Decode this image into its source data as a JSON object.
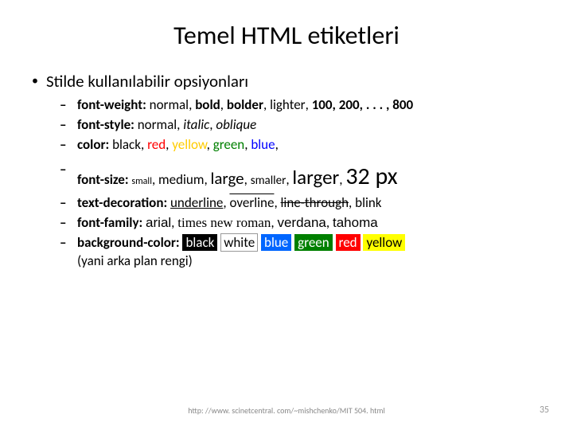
{
  "title": "Temel HTML etiketleri",
  "heading": "Stilde kullanılabilir opsiyonları",
  "props": {
    "fontWeight": "font-weight:",
    "fontStyle": "font-style:",
    "color": "color:",
    "fontSize": "font-size:",
    "textDecoration": "text-decoration:",
    "fontFamily": "font-family:",
    "backgroundColor": "background-color:"
  },
  "vals": {
    "fw": {
      "normal": "normal",
      "bold": "bold",
      "bolder": "bolder",
      "lighter": "lighter",
      "nums": "100, 200, . . . , 800"
    },
    "fs": {
      "normal": "normal",
      "italic": "italic",
      "oblique": "oblique"
    },
    "col": {
      "black": "black",
      "red": "red",
      "yellow": "yellow",
      "green": "green",
      "blue": "blue"
    },
    "sz": {
      "small": "small",
      "medium": "medium",
      "large": "large",
      "smaller": "smaller",
      "larger": "larger",
      "px32": "32 px"
    },
    "td": {
      "underline": "underline",
      "overline": "overline",
      "lineThrough": "line-through",
      "blink": "blink"
    },
    "ff": {
      "arial": "arial",
      "tnr": "times new roman",
      "verdana": "verdana",
      "tahoma": "tahoma"
    },
    "bg": {
      "black": "black",
      "white": "white",
      "blue": "blue",
      "green": "green",
      "red": "red",
      "yellow": "yellow",
      "note": "(yani arka plan rengi)"
    }
  },
  "sep": ", ",
  "footer": {
    "url": "http: //www. scinetcentral. com/~mishchenko/MIT 504. html",
    "page": "35"
  }
}
